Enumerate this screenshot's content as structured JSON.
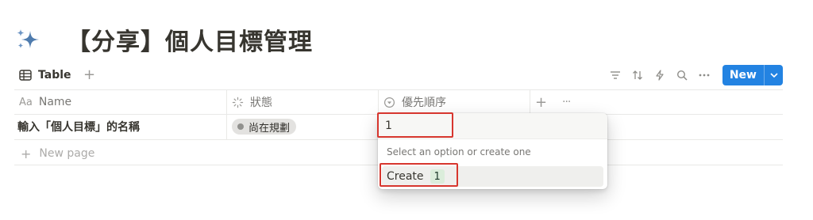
{
  "page": {
    "title": "【分享】個人目標管理",
    "icon": "sparkles-icon",
    "accent_color": "#2383e2"
  },
  "view_bar": {
    "tab_label": "Table",
    "tab_icon": "table-icon",
    "add_view_label": "+",
    "tools": [
      "filter-icon",
      "sort-icon",
      "automation-icon",
      "search-icon",
      "more-icon"
    ],
    "new_label": "New"
  },
  "table": {
    "columns": [
      {
        "label": "Name",
        "glyph": "Aa"
      },
      {
        "label": "狀態",
        "glyph": "status-icon"
      },
      {
        "label": "優先順序",
        "glyph": "select-icon"
      }
    ],
    "add_column_label": "+",
    "more_label": "···",
    "rows": [
      {
        "name": "輸入「個人目標」的名稱",
        "status": "尚在規劃",
        "priority": "1"
      }
    ],
    "new_page_label": "New page"
  },
  "dropdown": {
    "input_value": "1",
    "hint": "Select an option or create one",
    "create_label": "Create",
    "create_value": "1"
  },
  "colors": {
    "highlight": "#d7362e",
    "status_pill": "#e3e2e0",
    "option_chip": "#dbeddb"
  }
}
